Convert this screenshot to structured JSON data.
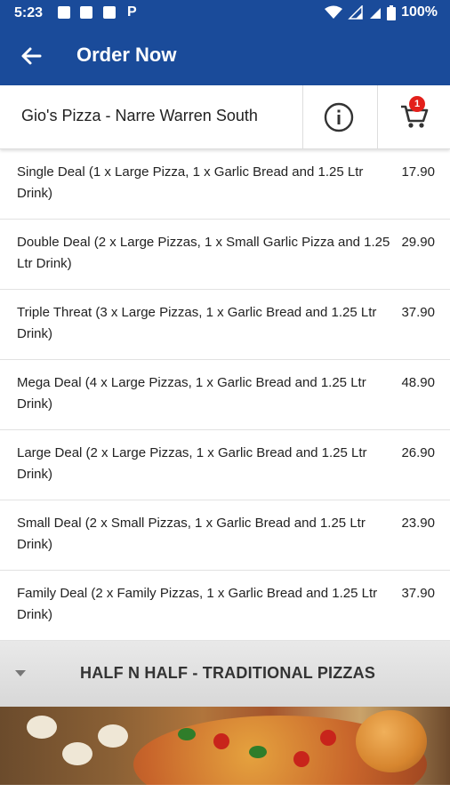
{
  "status_bar": {
    "time": "5:23",
    "battery": "100%"
  },
  "app_bar": {
    "title": "Order Now",
    "back_icon": "arrow-left-icon"
  },
  "store": {
    "name": "Gio's Pizza - Narre Warren South",
    "info_icon": "info-icon",
    "cart_icon": "cart-icon",
    "cart_count": "1"
  },
  "menu": {
    "items": [
      {
        "name": "Single Deal (1 x Large Pizza, 1 x Garlic Bread and 1.25 Ltr Drink)",
        "price": "17.90"
      },
      {
        "name": "Double Deal (2 x Large Pizzas, 1 x Small Garlic Pizza and 1.25 Ltr Drink)",
        "price": "29.90"
      },
      {
        "name": "Triple Threat (3 x Large Pizzas, 1 x Garlic Bread and 1.25 Ltr Drink)",
        "price": "37.90"
      },
      {
        "name": "Mega Deal (4 x Large Pizzas, 1 x Garlic Bread and 1.25 Ltr Drink)",
        "price": "48.90"
      },
      {
        "name": "Large Deal (2 x Large Pizzas, 1 x Garlic Bread and 1.25 Ltr Drink)",
        "price": "26.90"
      },
      {
        "name": "Small Deal (2 x Small Pizzas, 1 x Garlic Bread and 1.25 Ltr Drink)",
        "price": "23.90"
      },
      {
        "name": "Family Deal (2 x Family Pizzas, 1 x Garlic Bread and 1.25 Ltr Drink)",
        "price": "37.90"
      }
    ]
  },
  "section": {
    "title": "HALF N HALF - TRADITIONAL PIZZAS"
  },
  "colors": {
    "primary": "#1a4b9a",
    "badge": "#e3201b"
  }
}
